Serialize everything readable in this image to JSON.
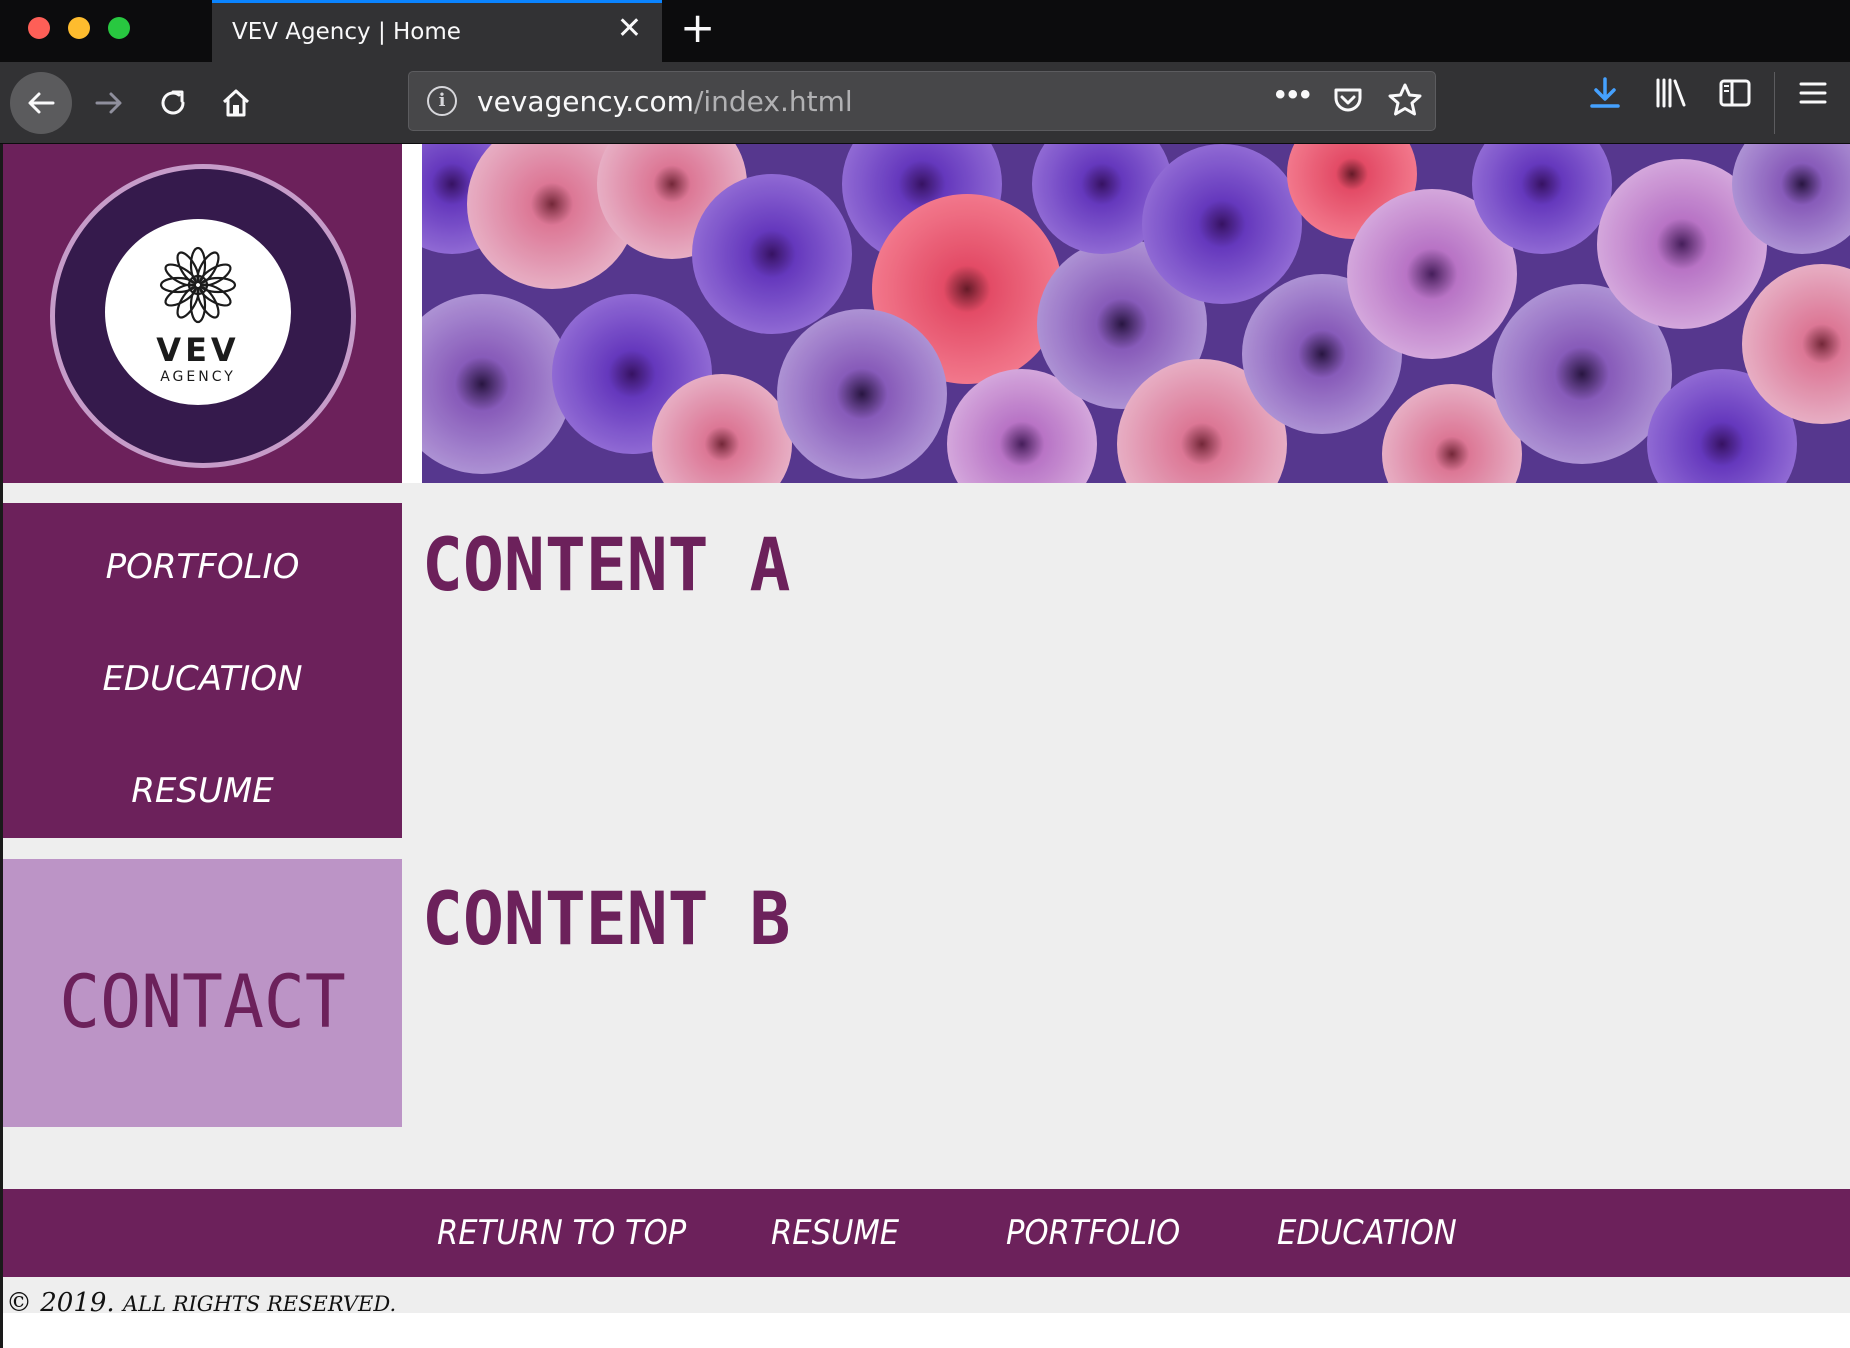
{
  "browser": {
    "tab_title": "VEV Agency | Home",
    "tab_close": "✕",
    "new_tab": "+",
    "url_host": "vevagency.com",
    "url_path": "/index.html",
    "page_actions": "•••",
    "icons": [
      "back-arrow-icon",
      "forward-arrow-icon",
      "reload-icon",
      "home-icon",
      "site-info-icon",
      "pocket-icon",
      "bookmark-star-icon",
      "download-icon",
      "library-icon",
      "sidebar-icon",
      "hamburger-menu-icon"
    ],
    "accent_color": "#0a84ff"
  },
  "logo": {
    "name": "VEV",
    "sub": "AGENCY"
  },
  "nav": {
    "items": [
      {
        "label": "PORTFOLIO"
      },
      {
        "label": "EDUCATION"
      },
      {
        "label": "RESUME"
      }
    ]
  },
  "contact": {
    "label": "CONTACT"
  },
  "content": {
    "a_title": "CONTENT A",
    "b_title": "CONTENT B"
  },
  "footer": {
    "links": [
      {
        "label": "RETURN TO TOP"
      },
      {
        "label": "RESUME"
      },
      {
        "label": "PORTFOLIO"
      },
      {
        "label": "EDUCATION"
      }
    ],
    "copyright_year": "© 2019.",
    "copyright_text": "ALL RIGHTS RESERVED."
  },
  "colors": {
    "primary": "#6c215b",
    "secondary": "#bc94c6",
    "ring_dark": "#351a4c",
    "background": "#eeeeee"
  }
}
